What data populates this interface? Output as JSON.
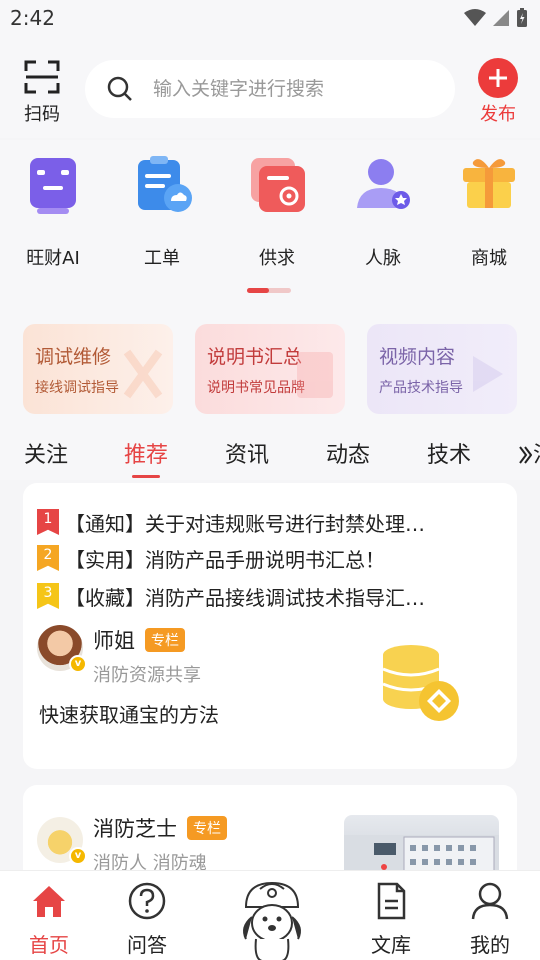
{
  "status": {
    "time": "2:42"
  },
  "header": {
    "scan_label": "扫码",
    "search_placeholder": "输入关键字进行搜索",
    "publish_label": "发布"
  },
  "apps": [
    {
      "label": "旺财AI",
      "icon": "robot-icon"
    },
    {
      "label": "工单",
      "icon": "work-order-icon"
    },
    {
      "label": "供求",
      "icon": "supply-demand-icon"
    },
    {
      "label": "人脉",
      "icon": "contacts-icon"
    },
    {
      "label": "商城",
      "icon": "gift-icon"
    }
  ],
  "quick_cards": [
    {
      "title": "调试维修",
      "subtitle": "接线调试指导"
    },
    {
      "title": "说明书汇总",
      "subtitle": "说明书常见品牌"
    },
    {
      "title": "视频内容",
      "subtitle": "产品技术指导"
    }
  ],
  "tabs": [
    "关注",
    "推荐",
    "资讯",
    "动态",
    "技术",
    "法"
  ],
  "active_tab": "推荐",
  "news": [
    {
      "rank": "1",
      "text": "【通知】关于对违规账号进行封禁处理…"
    },
    {
      "rank": "2",
      "text": "【实用】消防产品手册说明书汇总！"
    },
    {
      "rank": "3",
      "text": "【收藏】消防产品接线调试技术指导汇…"
    }
  ],
  "post1": {
    "author": "师姐",
    "badge": "专栏",
    "subtitle": "消防资源共享",
    "title": "快速获取通宝的方法",
    "verified": "v"
  },
  "post2": {
    "author": "消防芝士",
    "badge": "专栏",
    "subtitle": "消防人 消防魂",
    "verified": "v"
  },
  "bottom_nav": [
    {
      "label": "首页",
      "icon": "home-icon"
    },
    {
      "label": "问答",
      "icon": "question-icon"
    },
    {
      "label": "文库",
      "icon": "document-icon"
    },
    {
      "label": "我的",
      "icon": "user-icon"
    }
  ],
  "colors": {
    "accent": "#e64545",
    "badge": "#f59a23"
  }
}
